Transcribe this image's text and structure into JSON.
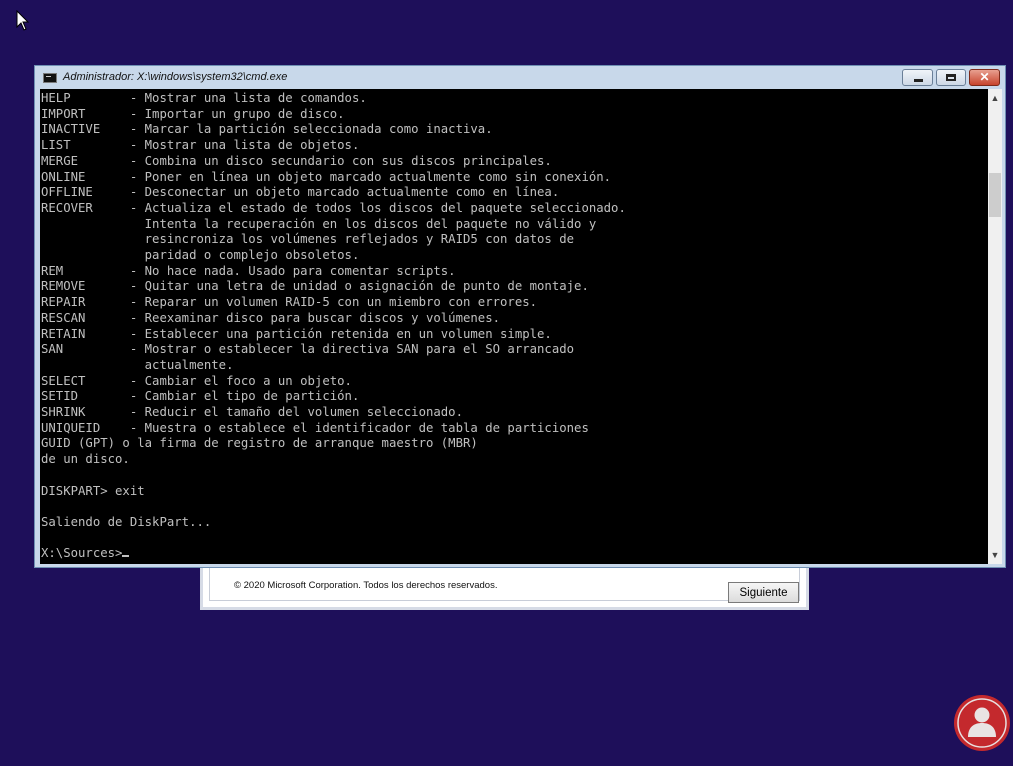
{
  "window": {
    "title": "Administrador: X:\\windows\\system32\\cmd.exe",
    "close_glyph": "✕"
  },
  "console": {
    "lines": [
      "HELP        - Mostrar una lista de comandos.",
      "IMPORT      - Importar un grupo de disco.",
      "INACTIVE    - Marcar la partición seleccionada como inactiva.",
      "LIST        - Mostrar una lista de objetos.",
      "MERGE       - Combina un disco secundario con sus discos principales.",
      "ONLINE      - Poner en línea un objeto marcado actualmente como sin conexión.",
      "OFFLINE     - Desconectar un objeto marcado actualmente como en línea.",
      "RECOVER     - Actualiza el estado de todos los discos del paquete seleccionado.",
      "              Intenta la recuperación en los discos del paquete no válido y",
      "              resincroniza los volúmenes reflejados y RAID5 con datos de",
      "              paridad o complejo obsoletos.",
      "REM         - No hace nada. Usado para comentar scripts.",
      "REMOVE      - Quitar una letra de unidad o asignación de punto de montaje.",
      "REPAIR      - Reparar un volumen RAID-5 con un miembro con errores.",
      "RESCAN      - Reexaminar disco para buscar discos y volúmenes.",
      "RETAIN      - Establecer una partición retenida en un volumen simple.",
      "SAN         - Mostrar o establecer la directiva SAN para el SO arrancado",
      "              actualmente.",
      "SELECT      - Cambiar el foco a un objeto.",
      "SETID       - Cambiar el tipo de partición.",
      "SHRINK      - Reducir el tamaño del volumen seleccionado.",
      "UNIQUEID    - Muestra o establece el identificador de tabla de particiones",
      "GUID (GPT) o la firma de registro de arranque maestro (MBR)",
      "de un disco.",
      "",
      "DISKPART> exit",
      "",
      "Saliendo de DiskPart...",
      ""
    ],
    "prompt": "X:\\Sources>"
  },
  "setup": {
    "copyright": "© 2020 Microsoft Corporation. Todos los derechos reservados.",
    "next_label": "Siguiente"
  },
  "scrollbar": {
    "up_glyph": "▲",
    "down_glyph": "▼"
  },
  "colors": {
    "desktop": "#1e0f5a",
    "console_bg": "#000000",
    "console_text": "#c0c0c0",
    "titlebar": "#c8d8ea",
    "logo_red": "#c4292d"
  },
  "icons": {
    "cursor": "mouse-pointer-icon",
    "title": "cmd-icon",
    "logo": "person-logo-icon"
  }
}
